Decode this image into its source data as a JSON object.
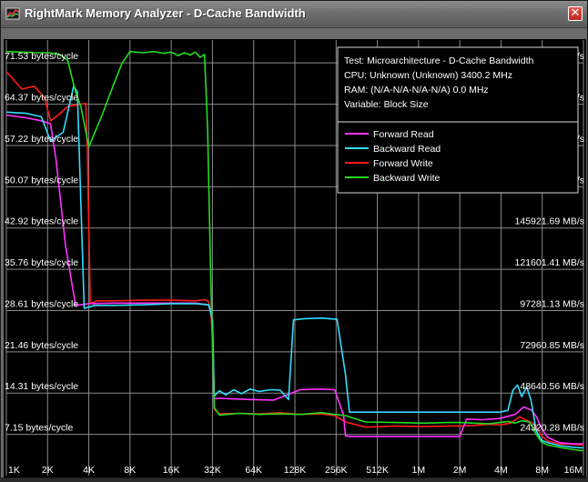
{
  "window": {
    "title": "RightMark Memory Analyzer - D-Cache Bandwidth",
    "close_label": "✕"
  },
  "colors": {
    "background": "#000000",
    "grid": "#8a8a8a",
    "forward_read": "#ff33ff",
    "backward_read": "#33ddff",
    "forward_write": "#ff1a1a",
    "backward_write": "#22dd22"
  },
  "info_box": {
    "lines": [
      "Test: Microarchitecture - D-Cache Bandwidth",
      "CPU: Unknown (Unknown) 3400.2 MHz",
      "RAM:  (N/A-N/A-N/A-N/A) 0.0 MHz",
      "Variable: Block Size"
    ]
  },
  "chart_data": {
    "type": "line",
    "title": "",
    "xlabel": "",
    "ylabel": "",
    "x_scale": "log2",
    "x_tick_labels": [
      "1K",
      "2K",
      "4K",
      "8K",
      "16K",
      "32K",
      "64K",
      "128K",
      "256K",
      "512K",
      "1M",
      "2M",
      "4M",
      "8M",
      "16M"
    ],
    "x_tick_kb": [
      1,
      2,
      4,
      8,
      16,
      32,
      64,
      128,
      256,
      512,
      1024,
      2048,
      4096,
      8192,
      16384
    ],
    "ylim": [
      0,
      75.5
    ],
    "y_left_labels": [
      "7.15 bytes/cycle",
      "14.31 bytes/cycle",
      "21.46 bytes/cycle",
      "28.61 bytes/cycle",
      "35.76 bytes/cycle",
      "42.92 bytes/cycle",
      "50.07 bytes/cycle",
      "57.22 bytes/cycle",
      "64.37 bytes/cycle",
      "71.53 bytes/cycle"
    ],
    "y_left_values": [
      7.15,
      14.31,
      21.46,
      28.61,
      35.76,
      42.92,
      50.07,
      57.22,
      64.37,
      71.53
    ],
    "y_right_labels": [
      "24320.28 MB/s",
      "48640.56 MB/s",
      "72960.85 MB/s",
      "97281.13 MB/s",
      "121601.41 MB/s",
      "145921.69 MB/s",
      "170241.97 MB/s",
      "194562.26 MB/s",
      "218882.53 MB/s",
      "243202.81 MB/s"
    ],
    "grid": true,
    "legend_position": "top-right",
    "series": [
      {
        "name": "Forward Read",
        "color": "#ff33ff",
        "x": [
          1,
          1.4,
          1.8,
          2.1,
          2.3,
          2.7,
          3.2,
          4,
          6,
          10,
          16,
          24,
          30,
          32,
          33,
          36,
          45,
          60,
          90,
          140,
          200,
          250,
          290,
          300,
          320,
          420,
          700,
          1100,
          1700,
          2048,
          2300,
          3000,
          4000,
          5200,
          6000,
          6800,
          7400,
          8100,
          9000,
          11000,
          14000,
          16384
        ],
        "y": [
          62.5,
          62.0,
          61.5,
          61.0,
          55,
          40,
          29.5,
          29.8,
          29.9,
          29.9,
          29.9,
          29.9,
          29.6,
          27,
          13.3,
          13.4,
          13.3,
          13.2,
          13.1,
          14.9,
          15.0,
          14.9,
          10.5,
          6.9,
          6.8,
          6.8,
          6.8,
          6.8,
          6.8,
          6.8,
          9.8,
          9.7,
          9.9,
          10.6,
          11.9,
          11.4,
          10.3,
          8.2,
          6.6,
          5.7,
          5.5,
          5.5
        ]
      },
      {
        "name": "Backward Read",
        "color": "#33ddff",
        "x": [
          1,
          1.4,
          1.8,
          2.1,
          2.6,
          3.1,
          3.3,
          3.7,
          4,
          4.4,
          5,
          6,
          10,
          16,
          24,
          30,
          32,
          33,
          36,
          40,
          46,
          52,
          60,
          70,
          85,
          100,
          115,
          125,
          150,
          200,
          260,
          300,
          320,
          420,
          700,
          1100,
          1700,
          2048,
          2600,
          3400,
          4000,
          4600,
          5000,
          5400,
          5800,
          6300,
          6800,
          7400,
          8100,
          9000,
          11000,
          14000,
          16384
        ],
        "y": [
          63.0,
          62.8,
          62.2,
          58,
          59.5,
          67.5,
          66.5,
          29.0,
          29.2,
          29.5,
          29.5,
          29.5,
          29.6,
          29.8,
          29.8,
          29.6,
          27,
          13.8,
          14.7,
          14.0,
          14.9,
          14.2,
          15.0,
          14.6,
          14.9,
          14.8,
          13.2,
          27.0,
          27.2,
          27.3,
          27.1,
          17.5,
          11.0,
          11.0,
          11.0,
          11.0,
          11.0,
          11.0,
          11.0,
          11.0,
          11.0,
          11.3,
          14.8,
          15.7,
          13.7,
          15.4,
          13.0,
          7.8,
          6.1,
          5.7,
          5.2,
          4.9,
          4.8
        ]
      },
      {
        "name": "Forward Write",
        "color": "#ff1a1a",
        "x": [
          1,
          1.3,
          1.6,
          1.9,
          2.1,
          2.4,
          2.8,
          3.2,
          3.5,
          3.8,
          3.9,
          4.1,
          4.6,
          6,
          10,
          16,
          24,
          28,
          30,
          31,
          32,
          33,
          36,
          50,
          70,
          100,
          140,
          200,
          250,
          300,
          420,
          700,
          1100,
          1700,
          2048,
          2600,
          3400,
          4000,
          4800,
          5600,
          6400,
          7200,
          8100,
          9000,
          11000,
          14000,
          16384
        ],
        "y": [
          70,
          67,
          67.5,
          65.5,
          61.5,
          62.5,
          64.0,
          64.2,
          64.4,
          64.5,
          57,
          29.8,
          30.3,
          30.3,
          30.4,
          30.4,
          30.3,
          30.5,
          30.2,
          28.5,
          24.5,
          11.5,
          10.7,
          10.8,
          10.7,
          10.9,
          10.6,
          10.7,
          10.4,
          9.3,
          8.4,
          8.6,
          8.5,
          8.6,
          8.6,
          8.7,
          8.9,
          8.8,
          9.1,
          10.2,
          9.5,
          9.0,
          6.9,
          6.0,
          5.5,
          5.4,
          5.3
        ]
      },
      {
        "name": "Backward Write",
        "color": "#22dd22",
        "x": [
          1,
          1.3,
          1.6,
          2.0,
          2.4,
          2.8,
          3.2,
          3.5,
          4.0,
          5,
          6,
          7,
          8,
          10,
          12,
          14,
          16,
          18,
          20,
          22,
          24,
          26,
          28,
          29.5,
          31,
          32,
          33,
          36,
          50,
          70,
          100,
          140,
          200,
          250,
          300,
          420,
          700,
          1100,
          1700,
          2048,
          2600,
          3400,
          4000,
          4600,
          5200,
          5800,
          6600,
          7400,
          8100,
          9000,
          11000,
          14000,
          16384
        ],
        "y": [
          73.5,
          73.4,
          73.3,
          73.3,
          73.1,
          72.0,
          66.5,
          64.0,
          57.0,
          62.5,
          67.5,
          71.5,
          73.5,
          73.3,
          73.5,
          73.2,
          73.4,
          72.8,
          73.3,
          72.9,
          73.4,
          72.5,
          73.0,
          60.0,
          35.5,
          23.0,
          11.8,
          10.5,
          10.8,
          10.6,
          10.7,
          10.6,
          10.9,
          10.6,
          10.4,
          9.3,
          9.2,
          9.1,
          9.2,
          9.2,
          9.1,
          9.0,
          9.2,
          9.4,
          9.1,
          9.5,
          9.3,
          7.2,
          5.8,
          5.3,
          4.9,
          4.5,
          4.3
        ]
      }
    ]
  }
}
